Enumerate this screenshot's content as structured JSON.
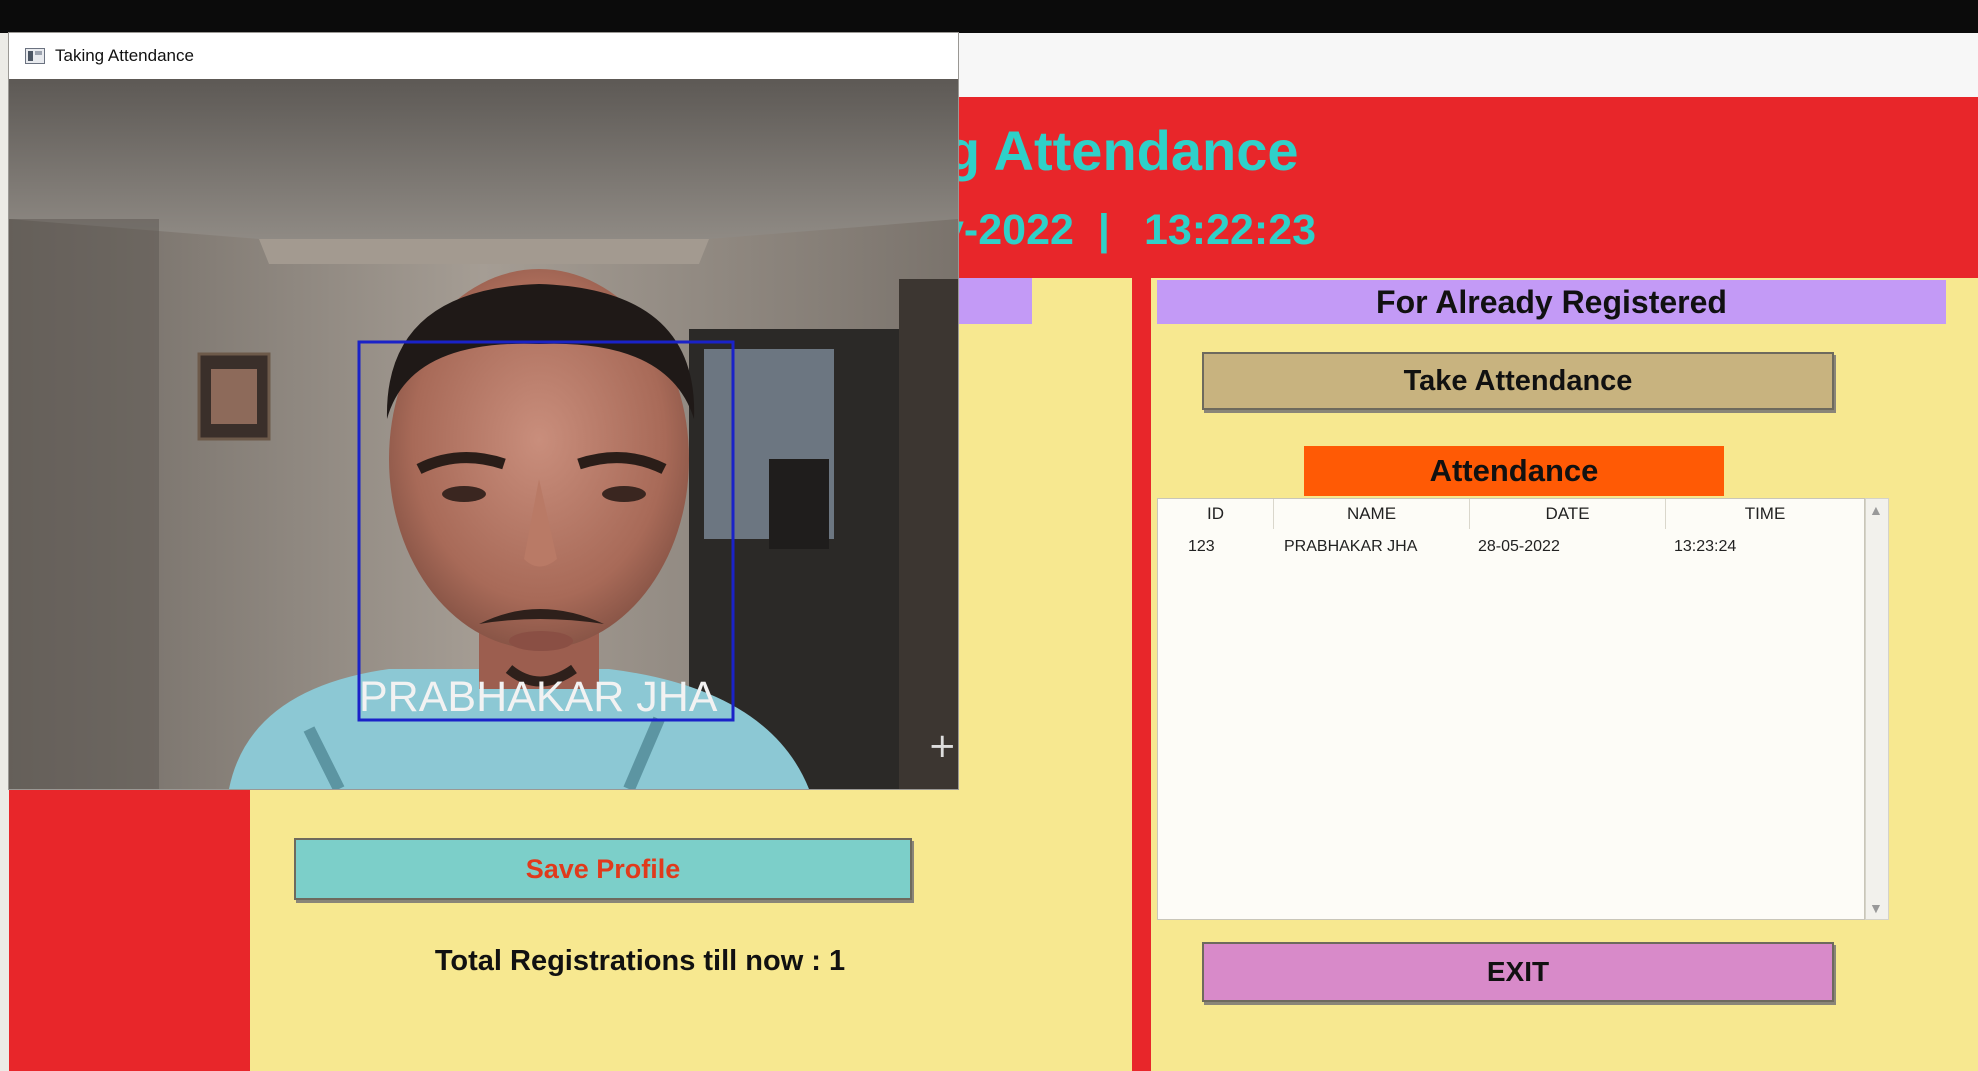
{
  "title_fragment": "d Tracking Attendance",
  "date_fragment": "y-2022",
  "separator": "|",
  "clock": "13:22:23",
  "registered_section": {
    "header": "For Already Registered",
    "take_attendance_label": "Take Attendance",
    "attendance_label": "Attendance",
    "table": {
      "columns": [
        "ID",
        "NAME",
        "DATE",
        "TIME"
      ],
      "rows": [
        {
          "id": "123",
          "name": "PRABHAKAR JHA",
          "date": "28-05-2022",
          "time": "13:23:24"
        }
      ]
    },
    "exit_label": "EXIT"
  },
  "new_registration": {
    "save_profile_label": "Save Profile",
    "total_registrations": "Total Registrations till now  : 1"
  },
  "camera_window": {
    "title": "Taking Attendance",
    "face_label": "PRABHAKAR  JHA",
    "box_color": "#1a22c8"
  },
  "colors": {
    "title_color": "#2fd0c9",
    "background_red": "#e8262a",
    "panel_yellow": "#f7e890",
    "header_lavender": "#c39af6",
    "attendance_orange": "#ff5a05"
  }
}
